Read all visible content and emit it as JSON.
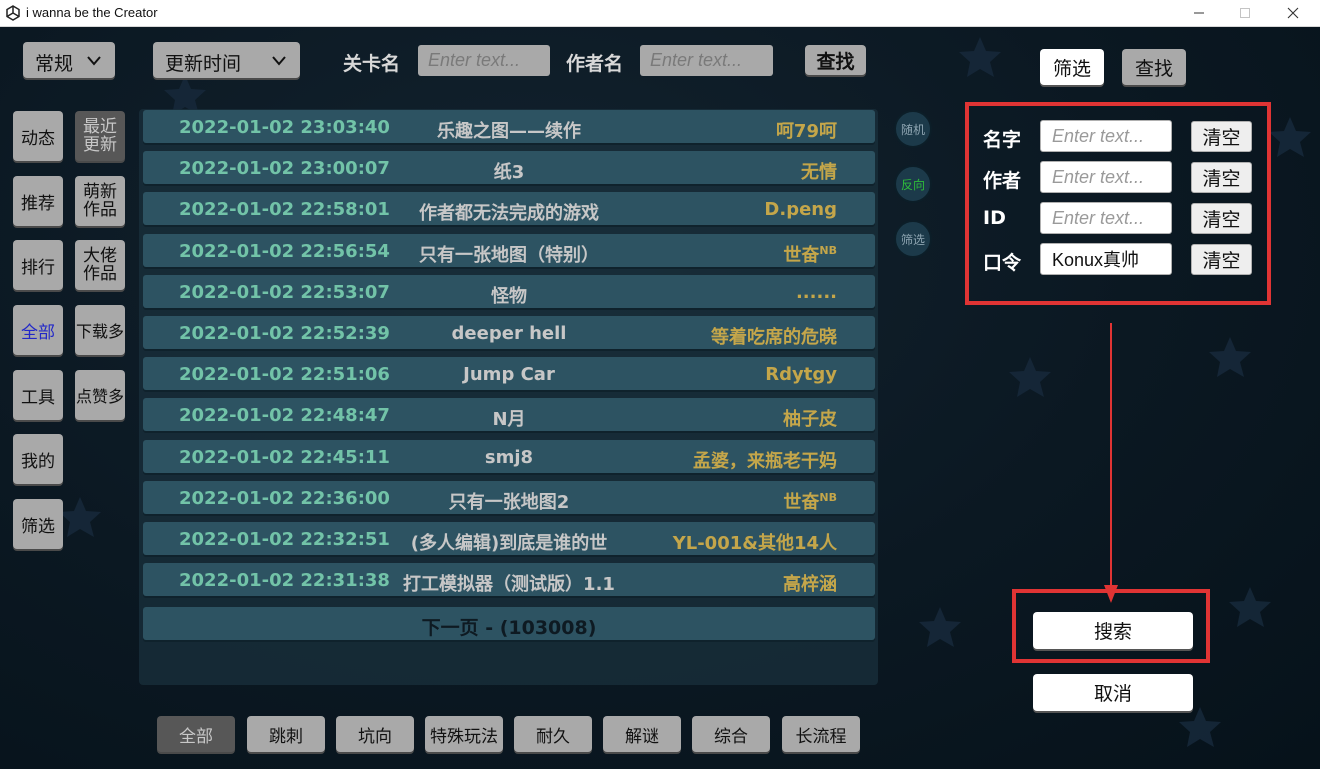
{
  "window": {
    "title": "i wanna be the Creator"
  },
  "top_bar": {
    "mode_dropdown": "常规",
    "sort_dropdown": "更新时间",
    "level_name_label": "关卡名",
    "level_name_placeholder": "Enter text...",
    "author_label": "作者名",
    "author_placeholder": "Enter text...",
    "find_label": "查找"
  },
  "left_nav": [
    {
      "label": "动态"
    },
    {
      "label": "最近更新"
    },
    {
      "label": "推荐"
    },
    {
      "label": "萌新作品"
    },
    {
      "label": "排行"
    },
    {
      "label": "大佬作品"
    },
    {
      "label": "全部"
    },
    {
      "label": "下载多"
    },
    {
      "label": "工具"
    },
    {
      "label": "点赞多"
    },
    {
      "label": "我的"
    },
    {
      "label": "筛选"
    }
  ],
  "levels": [
    {
      "date": "2022-01-02 23:03:40",
      "name": "乐趣之图——续作",
      "author": "呵79呵",
      "sup": ""
    },
    {
      "date": "2022-01-02 23:00:07",
      "name": "纸3",
      "author": "无情",
      "sup": ""
    },
    {
      "date": "2022-01-02 22:58:01",
      "name": "作者都无法完成的游戏",
      "author": "D.peng",
      "sup": ""
    },
    {
      "date": "2022-01-02 22:56:54",
      "name": "只有一张地图（特别）",
      "author": "世奋",
      "sup": "NB"
    },
    {
      "date": "2022-01-02 22:53:07",
      "name": "怪物",
      "author": "......",
      "sup": ""
    },
    {
      "date": "2022-01-02 22:52:39",
      "name": "deeper hell",
      "author": "等着吃席的危晓",
      "sup": ""
    },
    {
      "date": "2022-01-02 22:51:06",
      "name": "Jump Car",
      "author": "Rdytgy",
      "sup": ""
    },
    {
      "date": "2022-01-02 22:48:47",
      "name": "N月",
      "author": "柚子皮",
      "sup": ""
    },
    {
      "date": "2022-01-02 22:45:11",
      "name": "smj8",
      "author": "孟婆，来瓶老干妈",
      "sup": ""
    },
    {
      "date": "2022-01-02 22:36:00",
      "name": "只有一张地图2",
      "author": "世奋",
      "sup": "NB"
    },
    {
      "date": "2022-01-02 22:32:51",
      "name": "(多人编辑)到底是谁的世",
      "author": "YL-001&其他14人",
      "sup": ""
    },
    {
      "date": "2022-01-02 22:31:38",
      "name": "打工模拟器（测试版）1.1",
      "author": "高梓涵",
      "sup": ""
    }
  ],
  "next_page": "下一页 - (103008)",
  "side_circles": {
    "random": "随机",
    "reverse": "反向",
    "filter": "筛选"
  },
  "categories": [
    "全部",
    "跳刺",
    "坑向",
    "特殊玩法",
    "耐久",
    "解谜",
    "综合",
    "长流程"
  ],
  "right_panel": {
    "filter_tab": "筛选",
    "find_tab": "查找",
    "fields": [
      {
        "label": "名字",
        "value": "",
        "placeholder": "Enter text..."
      },
      {
        "label": "作者",
        "value": "",
        "placeholder": "Enter text..."
      },
      {
        "label": "ID",
        "value": "",
        "placeholder": "Enter text..."
      },
      {
        "label": "口令",
        "value": "Konux真帅",
        "placeholder": ""
      }
    ],
    "clear_label": "清空",
    "search_label": "搜索",
    "cancel_label": "取消"
  },
  "colors": {
    "highlight_red": "#e03434",
    "row_bg": "#2d5362",
    "date_text": "#72c3a8",
    "author_text": "#c4a64a"
  }
}
